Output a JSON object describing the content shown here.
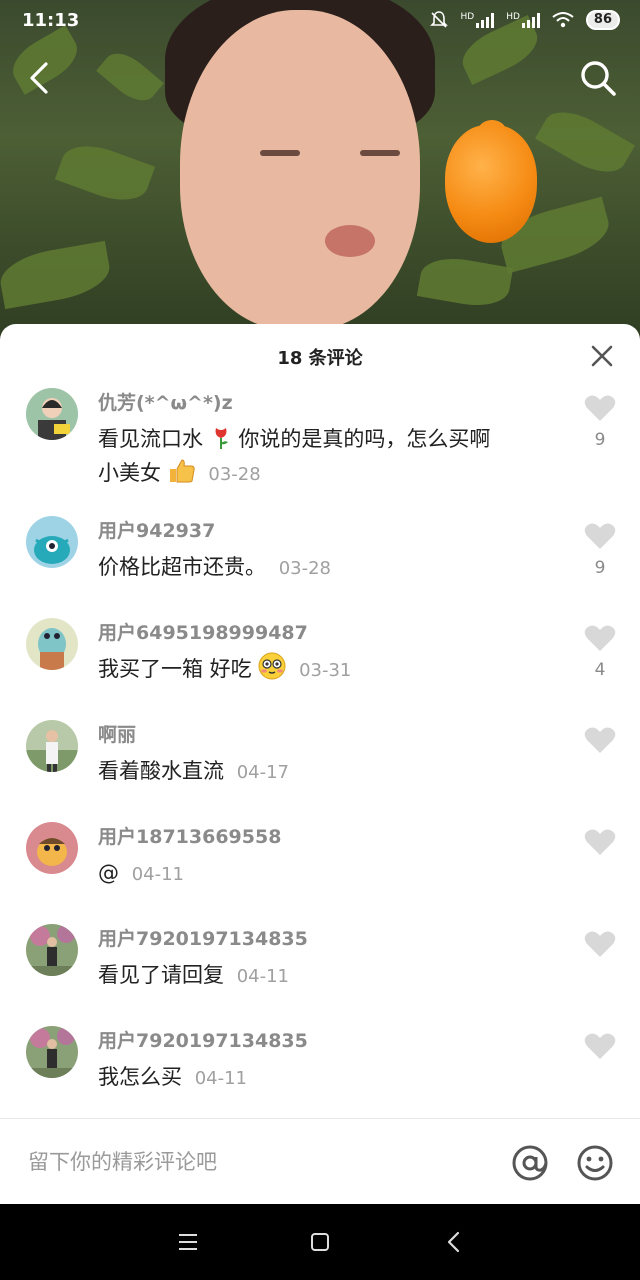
{
  "status_bar": {
    "time": "11:13",
    "battery": "86",
    "network_1": "HD",
    "network_2": "HD"
  },
  "sheet": {
    "title": "18 条评论"
  },
  "comments": [
    {
      "user": "仇芳(*^ω^*)z",
      "text_1": "看见流口水",
      "text_2": "你说的是真的吗，怎么买啊",
      "text_3": "小美女",
      "date": "03-28",
      "likes": "9"
    },
    {
      "user": "用户942937",
      "text": "价格比超市还贵。",
      "date": "03-28",
      "likes": "9"
    },
    {
      "user": "用户6495198999487",
      "text": "我买了一箱 好吃",
      "date": "03-31",
      "likes": "4"
    },
    {
      "user": "啊丽",
      "text": "看着酸水直流",
      "date": "04-17",
      "likes": ""
    },
    {
      "user": "用户18713669558",
      "text": "@",
      "date": "04-11",
      "likes": ""
    },
    {
      "user": "用户7920197134835",
      "text": "看见了请回复",
      "date": "04-11",
      "likes": ""
    },
    {
      "user": "用户7920197134835",
      "text": "我怎么买",
      "date": "04-11",
      "likes": ""
    }
  ],
  "input": {
    "placeholder": "留下你的精彩评论吧"
  },
  "icons": {
    "back": "chevron-left-icon",
    "search": "search-icon",
    "close": "close-icon",
    "like": "heart-icon",
    "at": "at-icon",
    "emoji": "smiley-icon",
    "menu": "menu-icon",
    "home": "square-icon",
    "sys_back": "triangle-back-icon"
  },
  "colors": {
    "sheet_bg": "#ffffff",
    "username": "#8a8a8a",
    "heart": "#d8d8d8"
  }
}
